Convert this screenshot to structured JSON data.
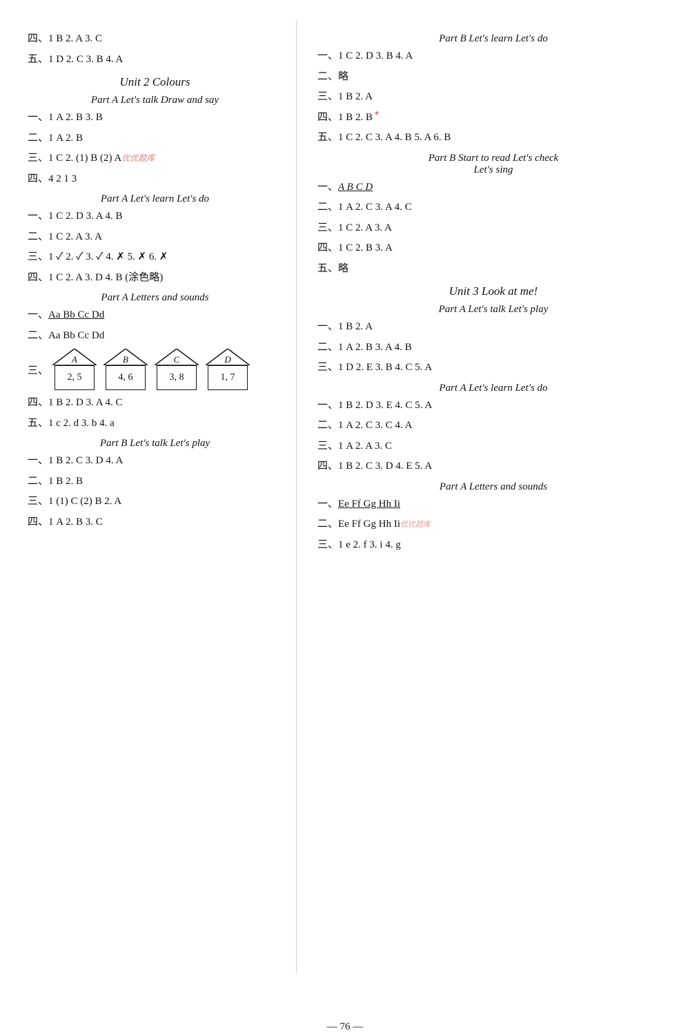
{
  "page_number": "76",
  "left_column": {
    "opening_lines": [
      {
        "num": "四、",
        "content": "1 B  2. A  3. C"
      },
      {
        "num": "五、",
        "content": "1 D  2. C  3. B  4. A"
      }
    ],
    "unit2_title": "Unit 2   Colours",
    "part_a_talk": "Part A   Let's talk   Draw and say",
    "part_a_talk_items": [
      {
        "num": "一、",
        "content": "1 A  2. B  3. B"
      },
      {
        "num": "二、",
        "content": "1 A  2. B"
      },
      {
        "num": "三、",
        "content": "1 C  2. (1) B   (2) A"
      },
      {
        "num": "四、",
        "content": "4  2  1  3"
      }
    ],
    "part_a_learn": "Part A   Let's learn   Let's do",
    "part_a_learn_items": [
      {
        "num": "一、",
        "content": "1 C  2. D  3. A  4. B"
      },
      {
        "num": "二、",
        "content": "1 C  2. A  3. A"
      },
      {
        "num": "三、",
        "content": "1 ✓  2. ✓  3. ✓  4. ✗  5. ✗  6. ✗"
      },
      {
        "num": "四、",
        "content": "1 C  2. A  3. D  4. B (涂色略)"
      }
    ],
    "part_a_letters": "Part A   Letters and sounds",
    "letters_line1_prefix": "一、",
    "letters_line1": "Aa  Bb  Cc  Dd",
    "letters_line2": "二、Aa  Bb  Cc  Dd",
    "shapes_label": "三、",
    "shapes": [
      {
        "letter": "A",
        "values": "2, 5"
      },
      {
        "letter": "B",
        "values": "4, 6"
      },
      {
        "letter": "C",
        "values": "3, 8"
      },
      {
        "letter": "D",
        "values": "1, 7"
      }
    ],
    "part_a_letters_items": [
      {
        "num": "四、",
        "content": "1 B  2. D  3. A  4. C"
      },
      {
        "num": "五、",
        "content": "1 c  2. d  3. b  4. a"
      }
    ],
    "part_b_talk": "Part B   Let's talk   Let's play",
    "part_b_talk_items": [
      {
        "num": "一、",
        "content": "1 B  2. C  3. D  4. A"
      },
      {
        "num": "二、",
        "content": "1 B  2. B"
      },
      {
        "num": "三、",
        "content": "1 (1) C   (2) B  2. A"
      },
      {
        "num": "四、",
        "content": "1 A  2. B  3. C"
      }
    ]
  },
  "right_column": {
    "part_b_learn": "Part B   Let's learn   Let's do",
    "part_b_learn_items": [
      {
        "num": "一、",
        "content": "1 C  2. D  3. B  4. A"
      },
      {
        "num": "二、",
        "content": "略"
      },
      {
        "num": "三、",
        "content": "1 B  2. A"
      },
      {
        "num": "四、",
        "content": "1 B  2. B"
      },
      {
        "num": "五、",
        "content": "1 C  2. C  3. A  4. B  5. A  6. B"
      }
    ],
    "part_b_read": "Part B   Start to read   Let's check",
    "part_b_read_sub": "Let's sing",
    "part_b_read_items": [
      {
        "num": "一、",
        "content": "A  B  C  D"
      },
      {
        "num": "二、",
        "content": "1 A  2. C  3. A  4. C"
      },
      {
        "num": "三、",
        "content": "1 C  2. A  3. A"
      },
      {
        "num": "四、",
        "content": "1 C  2. B  3. A"
      },
      {
        "num": "五、",
        "content": "略"
      }
    ],
    "unit3_title": "Unit 3   Look at me!",
    "part_a_talk_u3": "Part A   Let's talk   Let's play",
    "part_a_talk_u3_items": [
      {
        "num": "一、",
        "content": "1 B  2. A"
      },
      {
        "num": "二、",
        "content": "1 A  2. B  3. A  4. B"
      },
      {
        "num": "三、",
        "content": "1 D  2. E  3. B  4. C  5. A"
      }
    ],
    "part_a_learn_u3": "Part A   Let's learn   Let's do",
    "part_a_learn_u3_items": [
      {
        "num": "一、",
        "content": "1 B  2. D  3. E  4. C  5. A"
      },
      {
        "num": "二、",
        "content": "1 A  2. C  3. C  4. A"
      },
      {
        "num": "三、",
        "content": "1 A  2. A  3. C"
      },
      {
        "num": "四、",
        "content": "1 B  2. C  3. D  4. E  5. A"
      }
    ],
    "part_a_letters_u3": "Part A   Letters and sounds",
    "letters_u3_line1_prefix": "一、",
    "letters_u3_line1": "Ee  Ff  Gg  Hh  Ii",
    "letters_u3_line2": "二、Ee  Ff  Gg  Hh  Ii",
    "letters_u3_line3": "三、1 e  2. f  3. i  4. g"
  }
}
